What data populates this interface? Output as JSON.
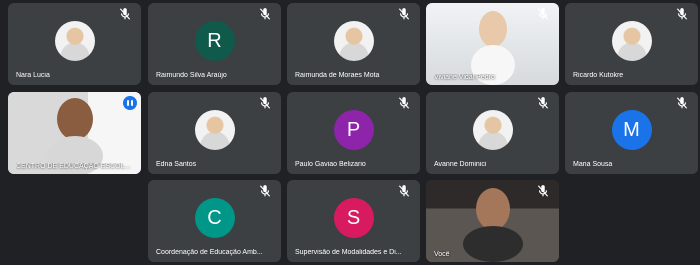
{
  "participants": [
    {
      "name": "Nara Lucia",
      "avatar_type": "photo",
      "muted": true
    },
    {
      "name": "Raimundo Silva Araújo",
      "initial": "R",
      "color": "#0f5a4a",
      "muted": true
    },
    {
      "name": "Raimunda de Moraes Mota",
      "avatar_type": "photo",
      "muted": true
    },
    {
      "name": "Viviane Vidal Pedro",
      "avatar_type": "video",
      "muted": true
    },
    {
      "name": "Ricardo Kutokre",
      "avatar_type": "photo",
      "muted": true
    },
    {
      "name": "CENTRO DE EDUCAÇÃO ESCOL...",
      "avatar_type": "video",
      "muted": false,
      "speaking": true
    },
    {
      "name": "Edna Santos",
      "avatar_type": "photo",
      "muted": true
    },
    {
      "name": "Paulo Gaviao Belizario",
      "initial": "P",
      "color": "#8e24aa",
      "muted": true
    },
    {
      "name": "Avanne Dominici",
      "avatar_type": "photo",
      "muted": true
    },
    {
      "name": "Maria Sousa",
      "initial": "M",
      "color": "#1a73e8",
      "muted": true
    },
    {
      "name": "Coordenação de Educação Amb...",
      "initial": "C",
      "color": "#009688",
      "muted": true
    },
    {
      "name": "Supervisão de Modalidades e Di...",
      "initial": "S",
      "color": "#d81b60",
      "muted": true
    },
    {
      "name": "Você",
      "avatar_type": "video",
      "muted": true
    }
  ]
}
